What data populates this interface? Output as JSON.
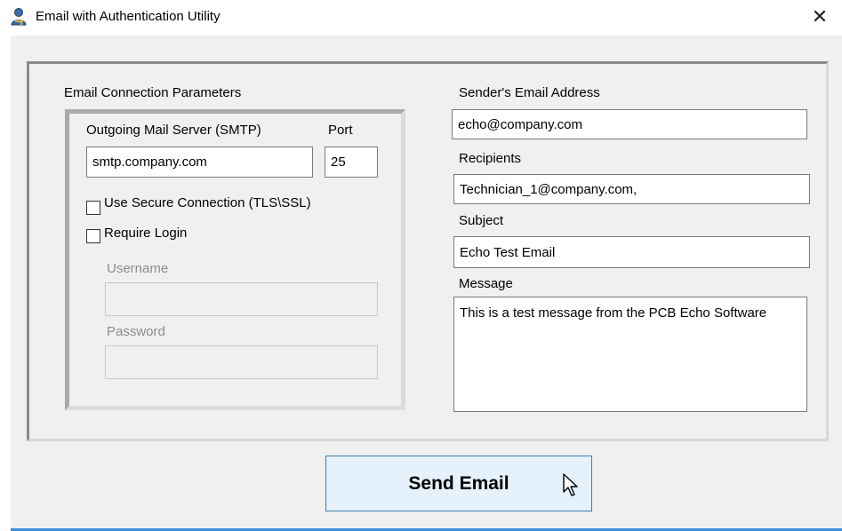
{
  "window": {
    "title": "Email with Authentication Utility",
    "close_glyph": "✕",
    "accent_color": "#3a8fe0"
  },
  "connection": {
    "group_label": "Email Connection Parameters",
    "smtp_label": "Outgoing Mail Server (SMTP)",
    "smtp_value": "smtp.company.com",
    "port_label": "Port",
    "port_value": "25",
    "secure_label": "Use Secure Connection (TLS\\SSL)",
    "secure_checked": false,
    "login_label": "Require Login",
    "login_checked": false,
    "username_label": "Username",
    "username_value": "",
    "password_label": "Password",
    "password_value": ""
  },
  "message": {
    "sender_label": "Sender's Email Address",
    "sender_value": "echo@company.com",
    "recipients_label": "Recipients",
    "recipients_value": "Technician_1@company.com,",
    "subject_label": "Subject",
    "subject_value": "Echo Test Email",
    "body_label": "Message",
    "body_value": "This is a test message from the PCB Echo Software"
  },
  "actions": {
    "send_label": "Send Email"
  },
  "icons": {
    "app": "user-key-icon",
    "close": "close-icon",
    "cursor": "mouse-pointer-icon"
  }
}
